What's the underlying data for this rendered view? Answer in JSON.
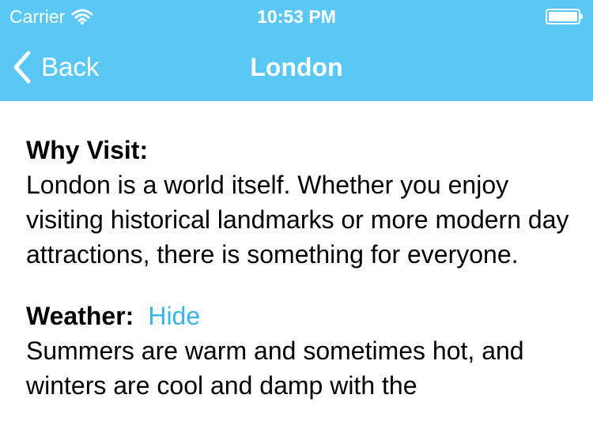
{
  "status_bar": {
    "carrier": "Carrier",
    "time": "10:53 PM",
    "icons": [
      "wifi-icon",
      "battery-icon"
    ]
  },
  "nav": {
    "back_label": "Back",
    "title": "London",
    "back_icon": "chevron-left-icon"
  },
  "colors": {
    "nav_background": "#5ac8f5",
    "nav_text": "#ffffff",
    "link": "#3bb4e8",
    "body_text": "#000000"
  },
  "sections": {
    "why_visit": {
      "title": "Why Visit:",
      "body": "London is a world itself. Whether you enjoy visiting historical landmarks or more modern day attractions, there is something for everyone."
    },
    "weather": {
      "title": "Weather:",
      "toggle_label": "Hide",
      "body": "Summers are warm and sometimes hot, and winters are cool and damp with the"
    }
  }
}
